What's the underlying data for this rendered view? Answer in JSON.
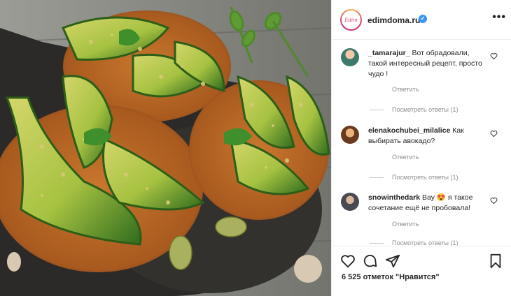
{
  "post": {
    "username": "edimdoma.ru",
    "avatar_text": "Edim",
    "verified_mark": "✓",
    "more_label": "•••"
  },
  "comments": [
    {
      "username": "_tamarajur_",
      "text": " Вот обрадовали, такой интересный рецепт, просто чудо !",
      "reply_label": "Ответить",
      "view_replies": "Посмотреть ответы (1)"
    },
    {
      "username": "elenakochubei_milalice",
      "text": " Как выбирать авокадо?",
      "reply_label": "Ответить",
      "view_replies": "Посмотреть ответы (1)"
    },
    {
      "username": "snowinthedark",
      "text": " Вау 😍 я такое сочетание ещё не пробовала!",
      "reply_label": "Ответить",
      "view_replies": "Посмотреть ответы (1)"
    }
  ],
  "actions": {
    "icons": [
      "heart-icon",
      "comment-icon",
      "share-icon",
      "bookmark-icon"
    ],
    "likes_text": "6 525 отметок \"Нравится\""
  },
  "colors": {
    "verified": "#3897f0",
    "secondary_text": "#8e8e8e",
    "primary_text": "#262626"
  }
}
